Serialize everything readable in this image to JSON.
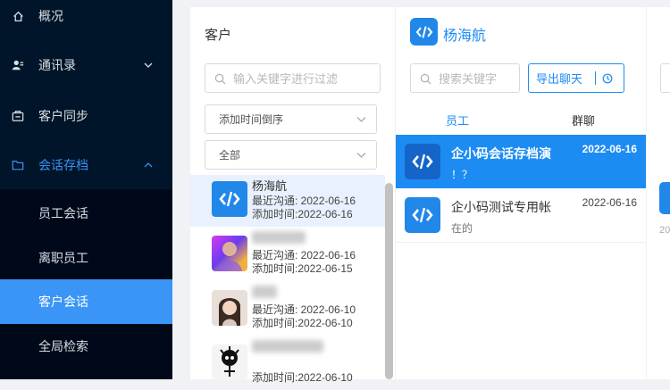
{
  "sidebar": {
    "items": [
      {
        "label": "概况",
        "icon": "home-icon"
      },
      {
        "label": "通讯录",
        "icon": "contacts-icon"
      },
      {
        "label": "客户同步",
        "icon": "sync-icon"
      },
      {
        "label": "会话存档",
        "icon": "folder-icon"
      }
    ],
    "subitems": [
      {
        "label": "员工会话"
      },
      {
        "label": "离职员工"
      },
      {
        "label": "客户会话"
      },
      {
        "label": "全局检索"
      }
    ]
  },
  "customers": {
    "title": "客户",
    "search_placeholder": "输入关键字进行过滤",
    "sort_select": "添加时间倒序",
    "filter_select": "全部",
    "list": [
      {
        "name": "杨海航",
        "last": "最近沟通: 2022-06-16",
        "added": "添加时间:2022-06-16"
      },
      {
        "name": "",
        "last": "最近沟通: 2022-06-16",
        "added": "添加时间:2022-06-15"
      },
      {
        "name": "",
        "last": "最近沟通: 2022-06-10",
        "added": "添加时间:2022-06-10"
      },
      {
        "name": "",
        "last": "",
        "added": "添加时间:2022-06-10"
      }
    ]
  },
  "chats": {
    "header_name": "杨海航",
    "search_placeholder": "搜索关键字",
    "export_label": "导出聊天",
    "tabs": [
      {
        "label": "员工"
      },
      {
        "label": "群聊"
      }
    ],
    "list": [
      {
        "name": "企小码会话存档演",
        "date": "2022-06-16",
        "preview": "！？"
      },
      {
        "name": "企小码测试专用帐",
        "date": "2022-06-16",
        "preview": "在的"
      }
    ]
  },
  "colors": {
    "accent": "#1c8cf3",
    "sidebar_bg": "#001529",
    "active_sub": "#3a95f7"
  }
}
